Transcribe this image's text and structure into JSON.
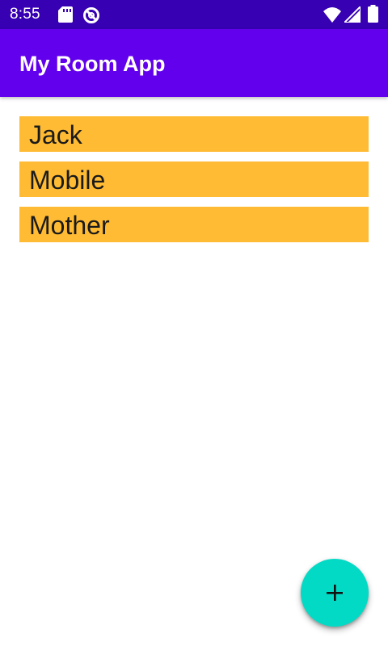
{
  "status_bar": {
    "time": "8:55",
    "icons": [
      "sd-card-icon",
      "no-disturb-icon",
      "wifi-icon",
      "signal-icon",
      "battery-icon"
    ],
    "background_color": "#3700b3"
  },
  "app_bar": {
    "title": "My Room App",
    "background_color": "#6200ee"
  },
  "list": {
    "item_color": "#ffbb33",
    "items": [
      {
        "label": "Jack"
      },
      {
        "label": "Mobile"
      },
      {
        "label": "Mother"
      }
    ]
  },
  "fab": {
    "icon": "plus-icon",
    "color": "#03dac5"
  }
}
